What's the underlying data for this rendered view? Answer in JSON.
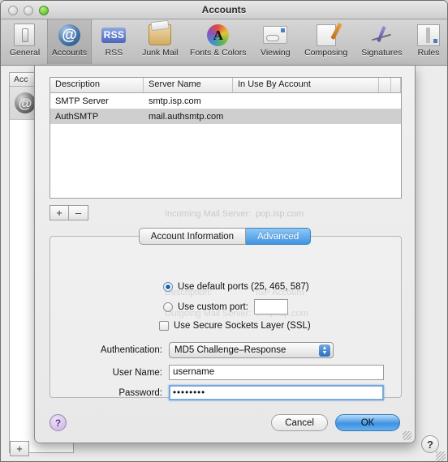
{
  "window": {
    "title": "Accounts",
    "controls": {
      "close": "close-button",
      "minimize": "minimize-button",
      "zoom": "zoom-button"
    }
  },
  "toolbar": {
    "items": [
      {
        "label": "General",
        "icon": "general-icon",
        "selected": false
      },
      {
        "label": "Accounts",
        "icon": "accounts-at-icon",
        "selected": true
      },
      {
        "label": "RSS",
        "icon": "rss-icon",
        "selected": false
      },
      {
        "label": "Junk Mail",
        "icon": "junk-mail-icon",
        "selected": false
      },
      {
        "label": "Fonts & Colors",
        "icon": "fonts-colors-icon",
        "selected": false
      },
      {
        "label": "Viewing",
        "icon": "viewing-icon",
        "selected": false
      },
      {
        "label": "Composing",
        "icon": "composing-icon",
        "selected": false
      },
      {
        "label": "Signatures",
        "icon": "signatures-icon",
        "selected": false
      },
      {
        "label": "Rules",
        "icon": "rules-icon",
        "selected": false
      }
    ]
  },
  "parent_window": {
    "sidebar_header": "Acc",
    "account_icon": "at-globe-icon",
    "add_button": "+",
    "help_button": "?",
    "ghost_text": {
      "incoming_label": "Incoming Mail Server:",
      "incoming_value": "pop.isp.com",
      "outgoing_label": "Outgoing Mail Server:",
      "outgoing_value": "smtp.isp.com",
      "description_label": "Description:",
      "description_value": "ISP Account"
    }
  },
  "sheet": {
    "table": {
      "columns": [
        "Description",
        "Server Name",
        "In Use By Account",
        "",
        ""
      ],
      "rows": [
        {
          "description": "SMTP Server",
          "server_name": "smtp.isp.com",
          "in_use_by_account": "",
          "selected": false
        },
        {
          "description": "AuthSMTP",
          "server_name": "mail.authsmtp.com",
          "in_use_by_account": "",
          "selected": true
        }
      ]
    },
    "list_buttons": {
      "add": "+",
      "remove": "–"
    },
    "tabs": [
      {
        "label": "Account Information",
        "active": false
      },
      {
        "label": "Advanced",
        "active": true
      }
    ],
    "form": {
      "default_ports_label": "Use default ports (25, 465, 587)",
      "default_ports_selected": true,
      "custom_port_label": "Use custom port:",
      "custom_port_selected": false,
      "custom_port_value": "",
      "ssl_label": "Use Secure Sockets Layer (SSL)",
      "ssl_checked": false,
      "authentication_label": "Authentication:",
      "authentication_value": "MD5 Challenge–Response",
      "username_label": "User Name:",
      "username_value": "username",
      "password_label": "Password:",
      "password_value": "••••••••"
    },
    "footer": {
      "help": "?",
      "cancel": "Cancel",
      "ok": "OK"
    }
  },
  "colors": {
    "accent_blue": "#3e93e2",
    "tab_active": "#3f94e4",
    "selection_grey": "#cfcfcf",
    "help_purple": "#c9afe0",
    "zoom_green": "#4eb224"
  }
}
